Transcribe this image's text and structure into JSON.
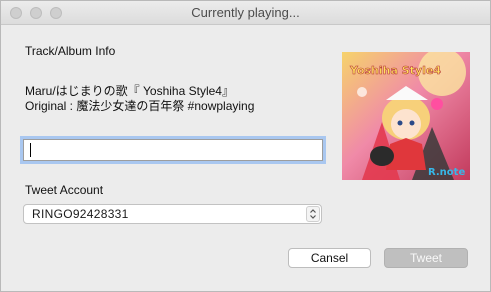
{
  "window": {
    "title": "Currently playing..."
  },
  "track": {
    "heading": "Track/Album Info",
    "song_line": "Maru/はじまりの歌『 Yoshiha Style4』",
    "original_line": "Original : 魔法少女達の百年祭 #nowplaying"
  },
  "tweet_input": {
    "value": ""
  },
  "account": {
    "label": "Tweet Account",
    "selected": "RINGO92428331"
  },
  "buttons": {
    "cancel_label": "Cansel",
    "tweet_label": "Tweet"
  },
  "album_art": {
    "title_text": "Yoshiha Style4",
    "logo_text": "R.note"
  },
  "colors": {
    "window_bg": "#ececec",
    "focus_ring": "#a9c7f0",
    "tweet_button_bg": "#bfbfbf"
  }
}
